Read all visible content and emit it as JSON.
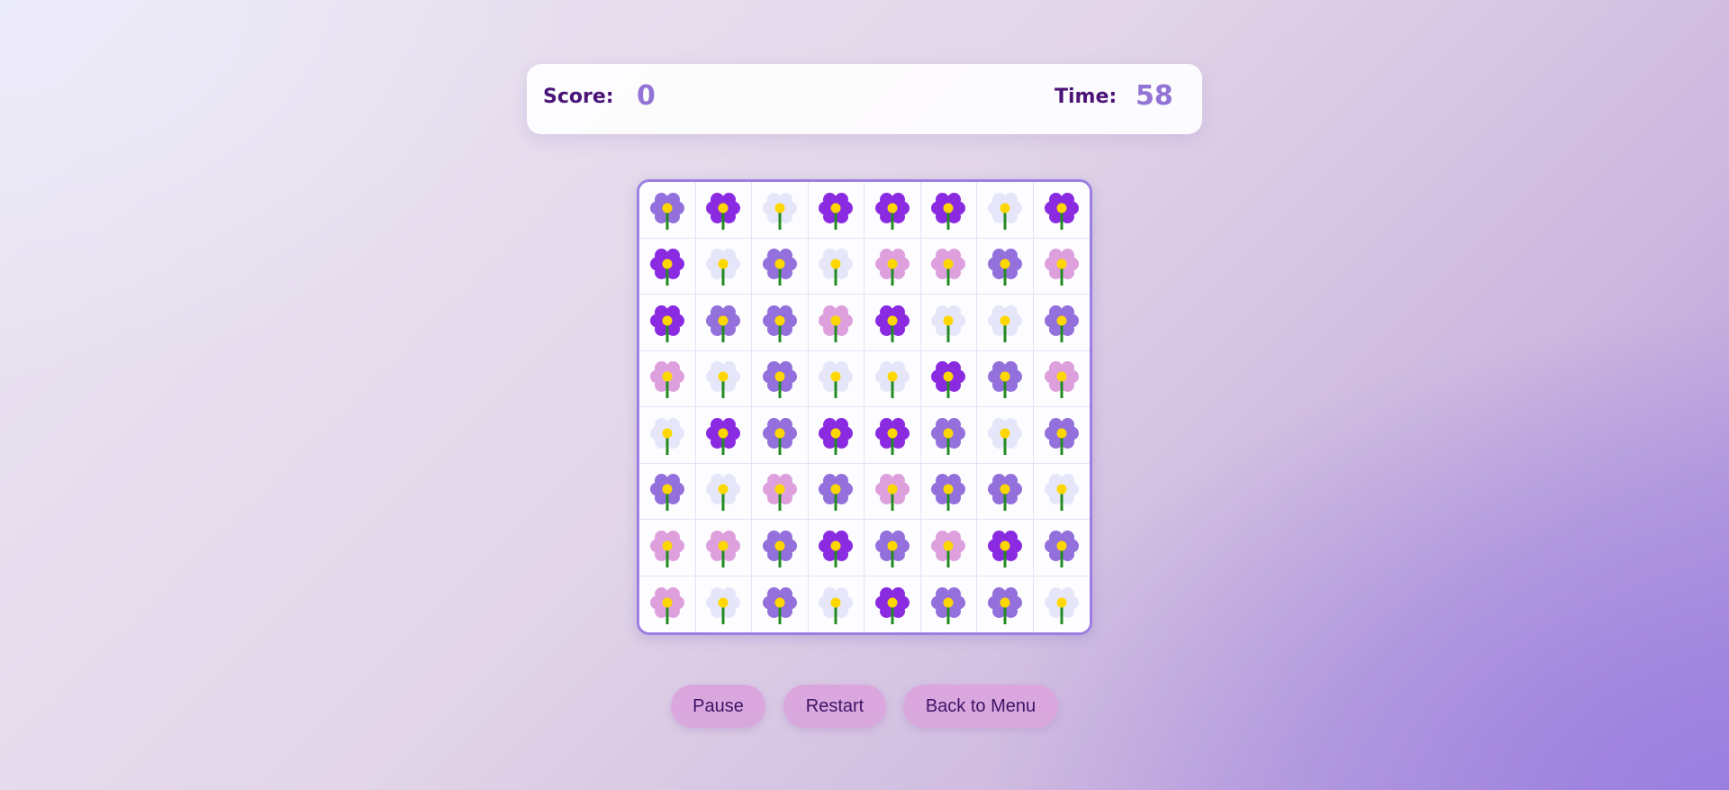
{
  "hud": {
    "score_label": "Score:",
    "score_value": "0",
    "time_label": "Time:",
    "time_value": "58"
  },
  "flower_colors": {
    "violet": "#8a2be2",
    "lavender": "#9370db",
    "pink": "#dda0dd",
    "white": "#e6e6fa",
    "center": "#ffd700",
    "stem": "#228b22"
  },
  "board": {
    "rows": 8,
    "cols": 8,
    "grid": [
      [
        "lavender",
        "violet",
        "white",
        "violet",
        "violet",
        "violet",
        "white",
        "violet"
      ],
      [
        "violet",
        "white",
        "lavender",
        "white",
        "pink",
        "pink",
        "lavender",
        "pink"
      ],
      [
        "violet",
        "lavender",
        "lavender",
        "pink",
        "violet",
        "white",
        "white",
        "lavender"
      ],
      [
        "pink",
        "white",
        "lavender",
        "white",
        "white",
        "violet",
        "lavender",
        "pink"
      ],
      [
        "white",
        "violet",
        "lavender",
        "violet",
        "violet",
        "lavender",
        "white",
        "lavender"
      ],
      [
        "lavender",
        "white",
        "pink",
        "lavender",
        "pink",
        "lavender",
        "lavender",
        "white"
      ],
      [
        "pink",
        "pink",
        "lavender",
        "violet",
        "lavender",
        "pink",
        "violet",
        "lavender"
      ],
      [
        "pink",
        "white",
        "lavender",
        "white",
        "violet",
        "lavender",
        "lavender",
        "white"
      ]
    ]
  },
  "controls": {
    "pause_label": "Pause",
    "restart_label": "Restart",
    "menu_label": "Back to Menu"
  }
}
